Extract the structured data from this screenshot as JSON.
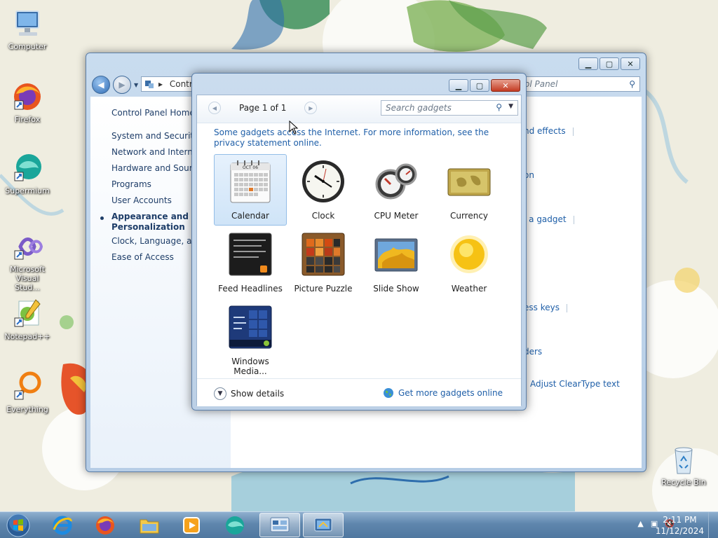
{
  "desktop": {
    "icons": [
      {
        "label": "Computer",
        "icon": "computer-icon"
      },
      {
        "label": "Firefox",
        "icon": "firefox-icon"
      },
      {
        "label": "Supermium",
        "icon": "supermium-icon"
      },
      {
        "label": "Microsoft Visual Stud...",
        "icon": "visual-studio-icon"
      },
      {
        "label": "Notepad++",
        "icon": "notepad-plus-icon"
      },
      {
        "label": "Everything",
        "icon": "everything-icon"
      },
      {
        "label": "Recycle Bin",
        "icon": "recycle-bin-icon"
      }
    ]
  },
  "control_panel": {
    "address": "Contr",
    "search_placeholder": "ol Panel",
    "sidebar": {
      "home": "Control Panel Home",
      "items": [
        "System and Security",
        "Network and Internet",
        "Hardware and Sound",
        "Programs",
        "User Accounts",
        "Appearance and Personalization",
        "Clock, Language, and",
        "Ease of Access"
      ],
      "active_index": 5
    },
    "right_links": [
      "nd effects",
      "on",
      "l a gadget",
      "ess keys",
      "ders",
      "Adjust ClearType text"
    ]
  },
  "gadget_gallery": {
    "page_label": "Page 1 of 1",
    "search_placeholder": "Search gadgets",
    "info_text": "Some gadgets access the Internet.  For more information, see the privacy statement online.",
    "gadgets": [
      {
        "name": "Calendar",
        "icon": "calendar-icon",
        "selected": true
      },
      {
        "name": "Clock",
        "icon": "clock-icon",
        "selected": false
      },
      {
        "name": "CPU Meter",
        "icon": "cpu-meter-icon",
        "selected": false
      },
      {
        "name": "Currency",
        "icon": "currency-icon",
        "selected": false
      },
      {
        "name": "Feed Headlines",
        "icon": "feed-headlines-icon",
        "selected": false
      },
      {
        "name": "Picture Puzzle",
        "icon": "picture-puzzle-icon",
        "selected": false
      },
      {
        "name": "Slide Show",
        "icon": "slide-show-icon",
        "selected": false
      },
      {
        "name": "Weather",
        "icon": "weather-icon",
        "selected": false
      },
      {
        "name": "Windows Media...",
        "icon": "windows-media-icon",
        "selected": false
      }
    ],
    "show_details": "Show details",
    "get_more": "Get more gadgets online",
    "calendar_month": "OCT 06"
  },
  "taskbar": {
    "time": "2:11 PM",
    "date": "11/12/2024",
    "pinned": [
      "internet-explorer-icon",
      "firefox-icon",
      "file-explorer-icon",
      "media-player-icon",
      "supermium-icon",
      "gadgets-icon",
      "control-panel-icon"
    ]
  }
}
